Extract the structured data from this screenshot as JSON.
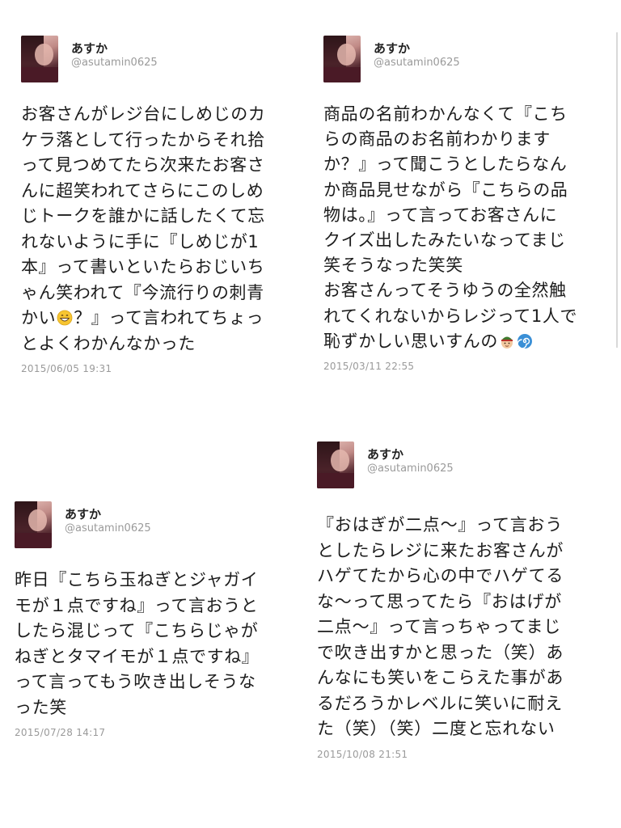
{
  "tweets": [
    {
      "display_name": "あすか",
      "handle": "@asutamin0625",
      "lines": [
        "お客さんがレジ台にしめじのカ",
        "ケラ落として行ったからそれ拾",
        "って見つめてたら次来たお客さ",
        "んに超笑われてさらにこのしめ",
        "じトークを誰かに話したくて忘",
        "れないように手に『しめじが1",
        "本』って書いといたらおじいち",
        "ゃん笑われて『今流行りの刺青",
        "かい",
        "？』って言われてちょっ",
        "とよくわかんなかった"
      ],
      "emoji": "grinning-face-emoji",
      "timestamp": "2015/06/05 19:31"
    },
    {
      "display_name": "あすか",
      "handle": "@asutamin0625",
      "lines": [
        "商品の名前わかんなくて『こち",
        "らの商品のお名前わかります",
        "か？』って聞こうとしたらなん",
        "か商品見せながら『こちらの品",
        "物は。』って言ってお客さんに",
        "クイズ出したみたいなってまじ",
        "笑そうなった笑笑",
        "お客さんってそうゆうの全然触",
        "れてくれないからレジって1人で",
        "恥ずかしい思いすんの"
      ],
      "emoji": [
        "man-with-cap-emoji",
        "cyclone-emoji"
      ],
      "timestamp": "2015/03/11 22:55"
    },
    {
      "display_name": "あすか",
      "handle": "@asutamin0625",
      "lines": [
        "昨日『こちら玉ねぎとジャガイ",
        "モが１点ですね』って言おうと",
        "したら混じって『こちらじゃが",
        "ねぎとタマイモが１点ですね』",
        "って言ってもう吹き出しそうな",
        "った笑"
      ],
      "timestamp": "2015/07/28 14:17"
    },
    {
      "display_name": "あすか",
      "handle": "@asutamin0625",
      "lines": [
        "『おはぎが二点〜』って言おう",
        "としたらレジに来たお客さんが",
        "ハゲてたから心の中でハゲてる",
        "な〜って思ってたら『おはげが",
        "二点〜』って言っちゃってまじ",
        "で吹き出すかと思った（笑）あ",
        "んなにも笑いをこらえた事があ",
        "るだろうかレベルに笑いに耐え",
        "た（笑）（笑）二度と忘れない"
      ],
      "timestamp": "2015/10/08 21:51"
    }
  ]
}
